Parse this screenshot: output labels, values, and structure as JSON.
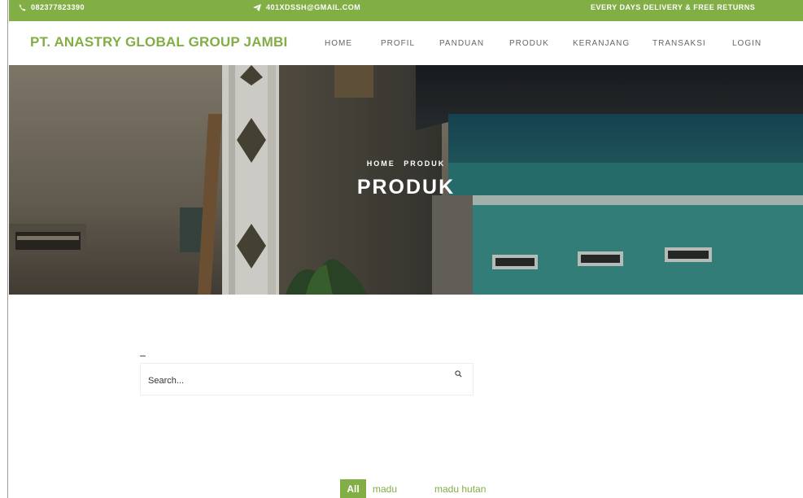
{
  "topbar": {
    "phone": "082377823390",
    "email": "401XDSSH@GMAIL.COM",
    "promo": "EVERY DAYS DELIVERY & FREE RETURNS"
  },
  "nav": {
    "brand": "PT. ANASTRY GLOBAL GROUP JAMBI",
    "items": [
      "HOME",
      "PROFIL",
      "PANDUAN",
      "PRODUK",
      "KERANJANG",
      "TRANSAKSI",
      "LOGIN"
    ]
  },
  "hero": {
    "breadcrumb": [
      "HOME",
      "PRODUK"
    ],
    "title": "PRODUK"
  },
  "search": {
    "placeholder": "Search..."
  },
  "filters": {
    "items": [
      "All",
      "madu",
      "madu hutan"
    ],
    "active": "All"
  },
  "colors": {
    "accent": "#82ae46",
    "text_muted": "#666666"
  },
  "icons": {
    "phone": "phone-icon",
    "email": "paper-plane-icon",
    "search": "search-icon"
  }
}
